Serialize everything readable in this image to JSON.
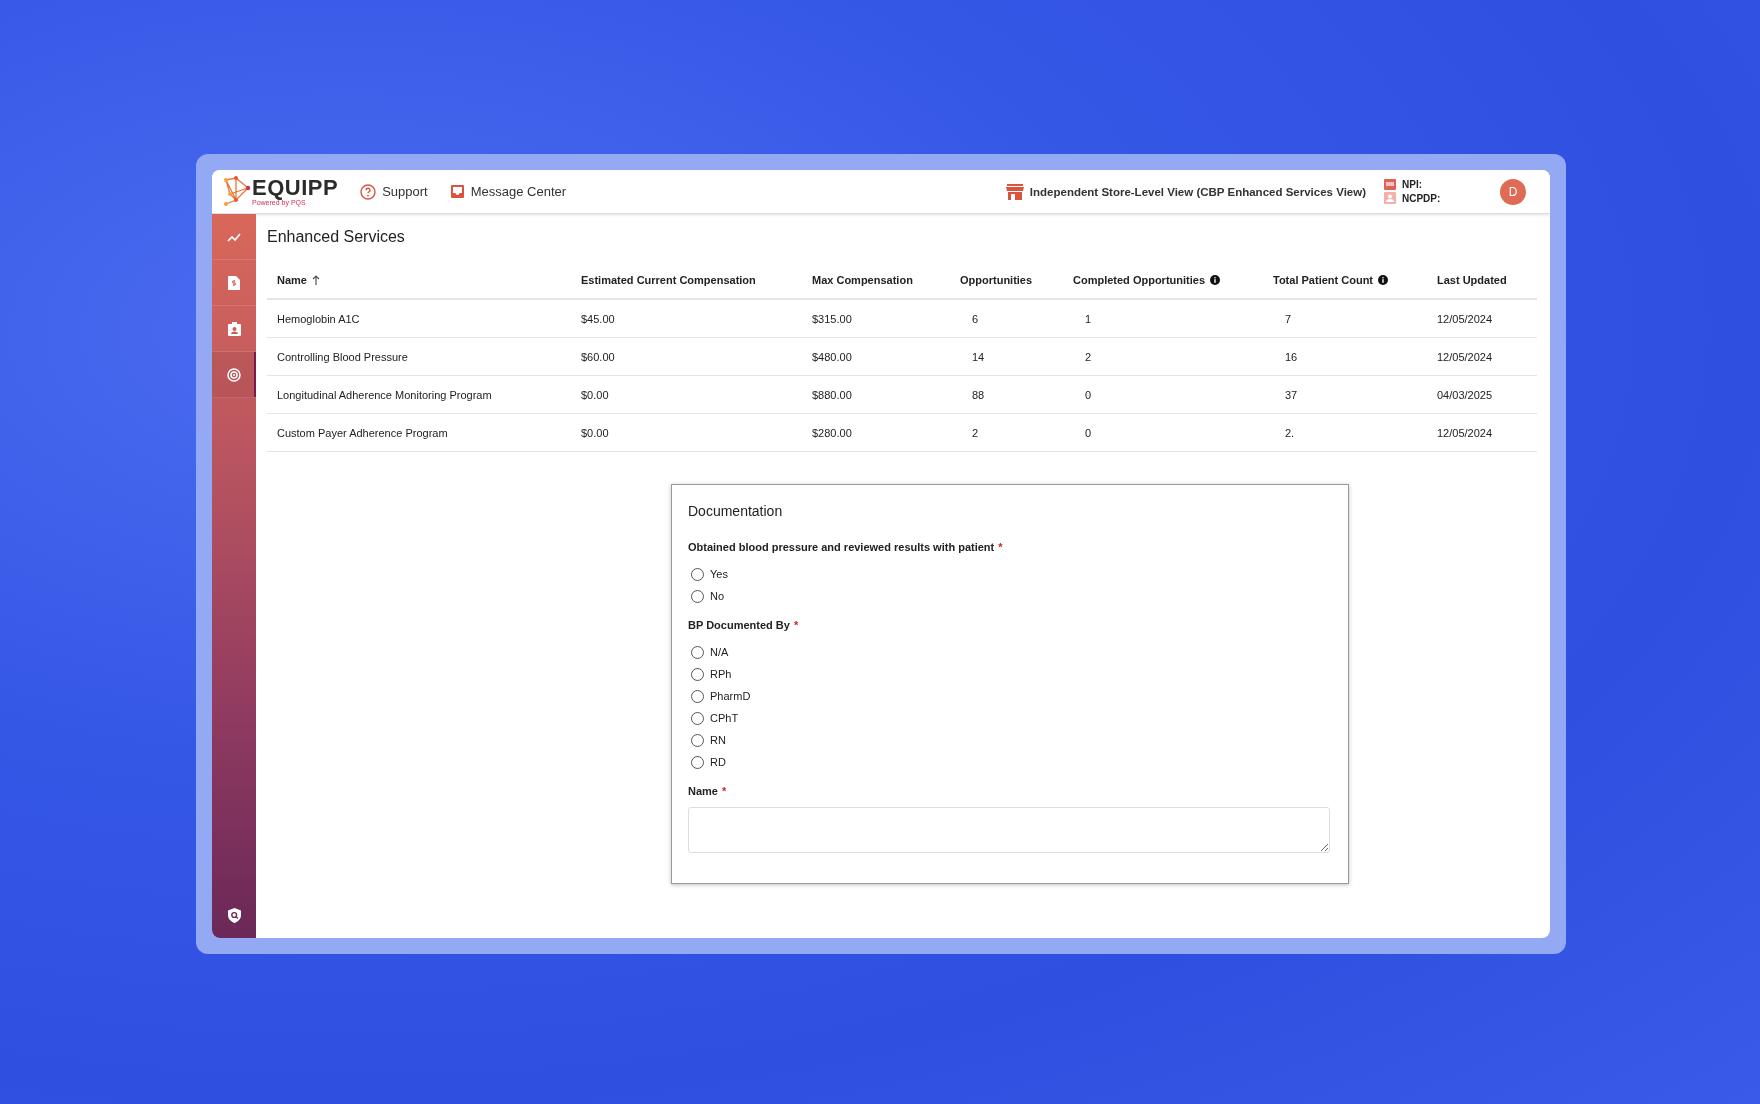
{
  "header": {
    "logo": {
      "name": "EQUIPP",
      "tagline": "Powered by PQS"
    },
    "nav": [
      {
        "kind": "help",
        "label": "Support"
      },
      {
        "kind": "inbox",
        "label": "Message Center"
      }
    ],
    "store_view": "Independent Store-Level View (CBP Enhanced Services View)",
    "ids": [
      {
        "kind": "number",
        "label": "NPI:"
      },
      {
        "kind": "card",
        "label": "NCPDP:"
      }
    ],
    "avatar": "D"
  },
  "sidebar": {
    "items": [
      {
        "kind": "trend",
        "selected": false
      },
      {
        "kind": "invoice",
        "selected": false
      },
      {
        "kind": "clipboard",
        "selected": false
      },
      {
        "kind": "target",
        "selected": true
      }
    ]
  },
  "page_title": "Enhanced Services",
  "table": {
    "columns": [
      {
        "label": "Name",
        "sorted_ascending": true,
        "info": false
      },
      {
        "label": "Estimated Current Compensation",
        "sorted_ascending": false,
        "info": false
      },
      {
        "label": "Max Compensation",
        "sorted_ascending": false,
        "info": false
      },
      {
        "label": "Opportunities",
        "sorted_ascending": false,
        "info": false
      },
      {
        "label": "Completed Opportunities",
        "sorted_ascending": false,
        "info": true
      },
      {
        "label": "Total Patient Count",
        "sorted_ascending": false,
        "info": true
      },
      {
        "label": "Last Updated",
        "sorted_ascending": false,
        "info": false
      }
    ],
    "rows": [
      [
        "Hemoglobin A1C",
        "$45.00",
        "$315.00",
        "6",
        "1",
        "7",
        "12/05/2024"
      ],
      [
        "Controlling Blood Pressure",
        "$60.00",
        "$480.00",
        "14",
        "2",
        "16",
        "12/05/2024"
      ],
      [
        "Longitudinal Adherence Monitoring Program",
        "$0.00",
        "$880.00",
        "88",
        "0",
        "37",
        "04/03/2025"
      ],
      [
        "Custom Payer Adherence Program",
        "$0.00",
        "$280.00",
        "2",
        "0",
        "2.",
        "12/05/2024"
      ]
    ]
  },
  "documentation": {
    "title": "Documentation",
    "fields": [
      {
        "kind": "radio",
        "label": "Obtained blood pressure and reviewed results with patient",
        "required_mark": "*",
        "options": [
          {
            "label": "Yes",
            "selected": false
          },
          {
            "label": "No",
            "selected": false
          }
        ]
      },
      {
        "kind": "radio",
        "label": "BP Documented By",
        "required_mark": "*",
        "options": [
          {
            "label": "N/A",
            "selected": false
          },
          {
            "label": "RPh",
            "selected": false
          },
          {
            "label": "PharmD",
            "selected": false
          },
          {
            "label": "CPhT",
            "selected": false
          },
          {
            "label": "RN",
            "selected": false
          },
          {
            "label": "RD",
            "selected": false
          }
        ]
      },
      {
        "kind": "textarea",
        "label": "Name",
        "required_mark": "*"
      }
    ]
  }
}
